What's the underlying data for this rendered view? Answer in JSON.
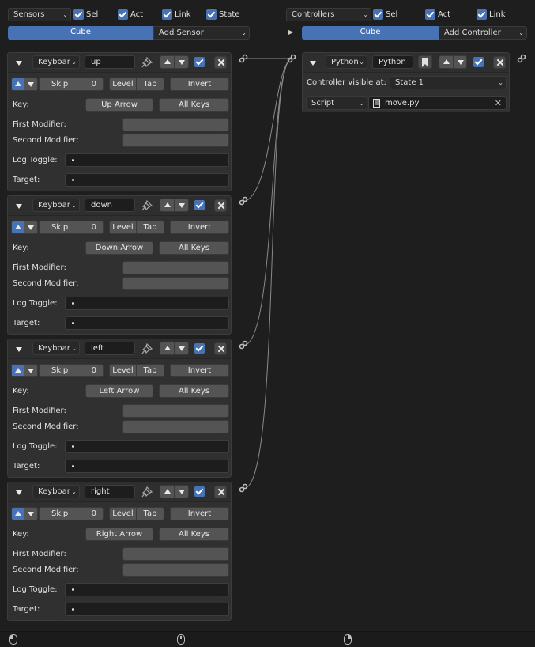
{
  "sensors_column": {
    "dropdown": "Sensors",
    "show_sel": "Sel",
    "show_act": "Act",
    "show_link": "Link",
    "show_state": "State",
    "object_tab": "Cube",
    "add_menu": "Add Sensor"
  },
  "controllers_column": {
    "dropdown": "Controllers",
    "show_sel": "Sel",
    "show_act": "Act",
    "show_link": "Link",
    "object_tab": "Cube",
    "add_menu": "Add Controller"
  },
  "sensors": [
    {
      "type": "Keyboar",
      "name": "up",
      "skip_label": "Skip",
      "skip_value": "0",
      "level": "Level",
      "tap": "Tap",
      "invert": "Invert",
      "key_label": "Key:",
      "key_value": "Up Arrow",
      "all_keys": "All Keys",
      "first_mod": "First Modifier:",
      "second_mod": "Second Modifier:",
      "log_toggle": "Log Toggle:",
      "target": "Target:"
    },
    {
      "type": "Keyboar",
      "name": "down",
      "skip_label": "Skip",
      "skip_value": "0",
      "level": "Level",
      "tap": "Tap",
      "invert": "Invert",
      "key_label": "Key:",
      "key_value": "Down Arrow",
      "all_keys": "All Keys",
      "first_mod": "First Modifier:",
      "second_mod": "Second Modifier:",
      "log_toggle": "Log Toggle:",
      "target": "Target:"
    },
    {
      "type": "Keyboar",
      "name": "left",
      "skip_label": "Skip",
      "skip_value": "0",
      "level": "Level",
      "tap": "Tap",
      "invert": "Invert",
      "key_label": "Key:",
      "key_value": "Left Arrow",
      "all_keys": "All Keys",
      "first_mod": "First Modifier:",
      "second_mod": "Second Modifier:",
      "log_toggle": "Log Toggle:",
      "target": "Target:"
    },
    {
      "type": "Keyboar",
      "name": "right",
      "skip_label": "Skip",
      "skip_value": "0",
      "level": "Level",
      "tap": "Tap",
      "invert": "Invert",
      "key_label": "Key:",
      "key_value": "Right Arrow",
      "all_keys": "All Keys",
      "first_mod": "First Modifier:",
      "second_mod": "Second Modifier:",
      "log_toggle": "Log Toggle:",
      "target": "Target:"
    }
  ],
  "controller": {
    "type": "Python",
    "name": "Python",
    "visible_label": "Controller visible at:",
    "state_value": "State 1",
    "mode": "Script",
    "script_file": "move.py"
  },
  "colors": {
    "accent": "#4772b3",
    "background": "#1e1e1e",
    "panel": "#303030"
  }
}
